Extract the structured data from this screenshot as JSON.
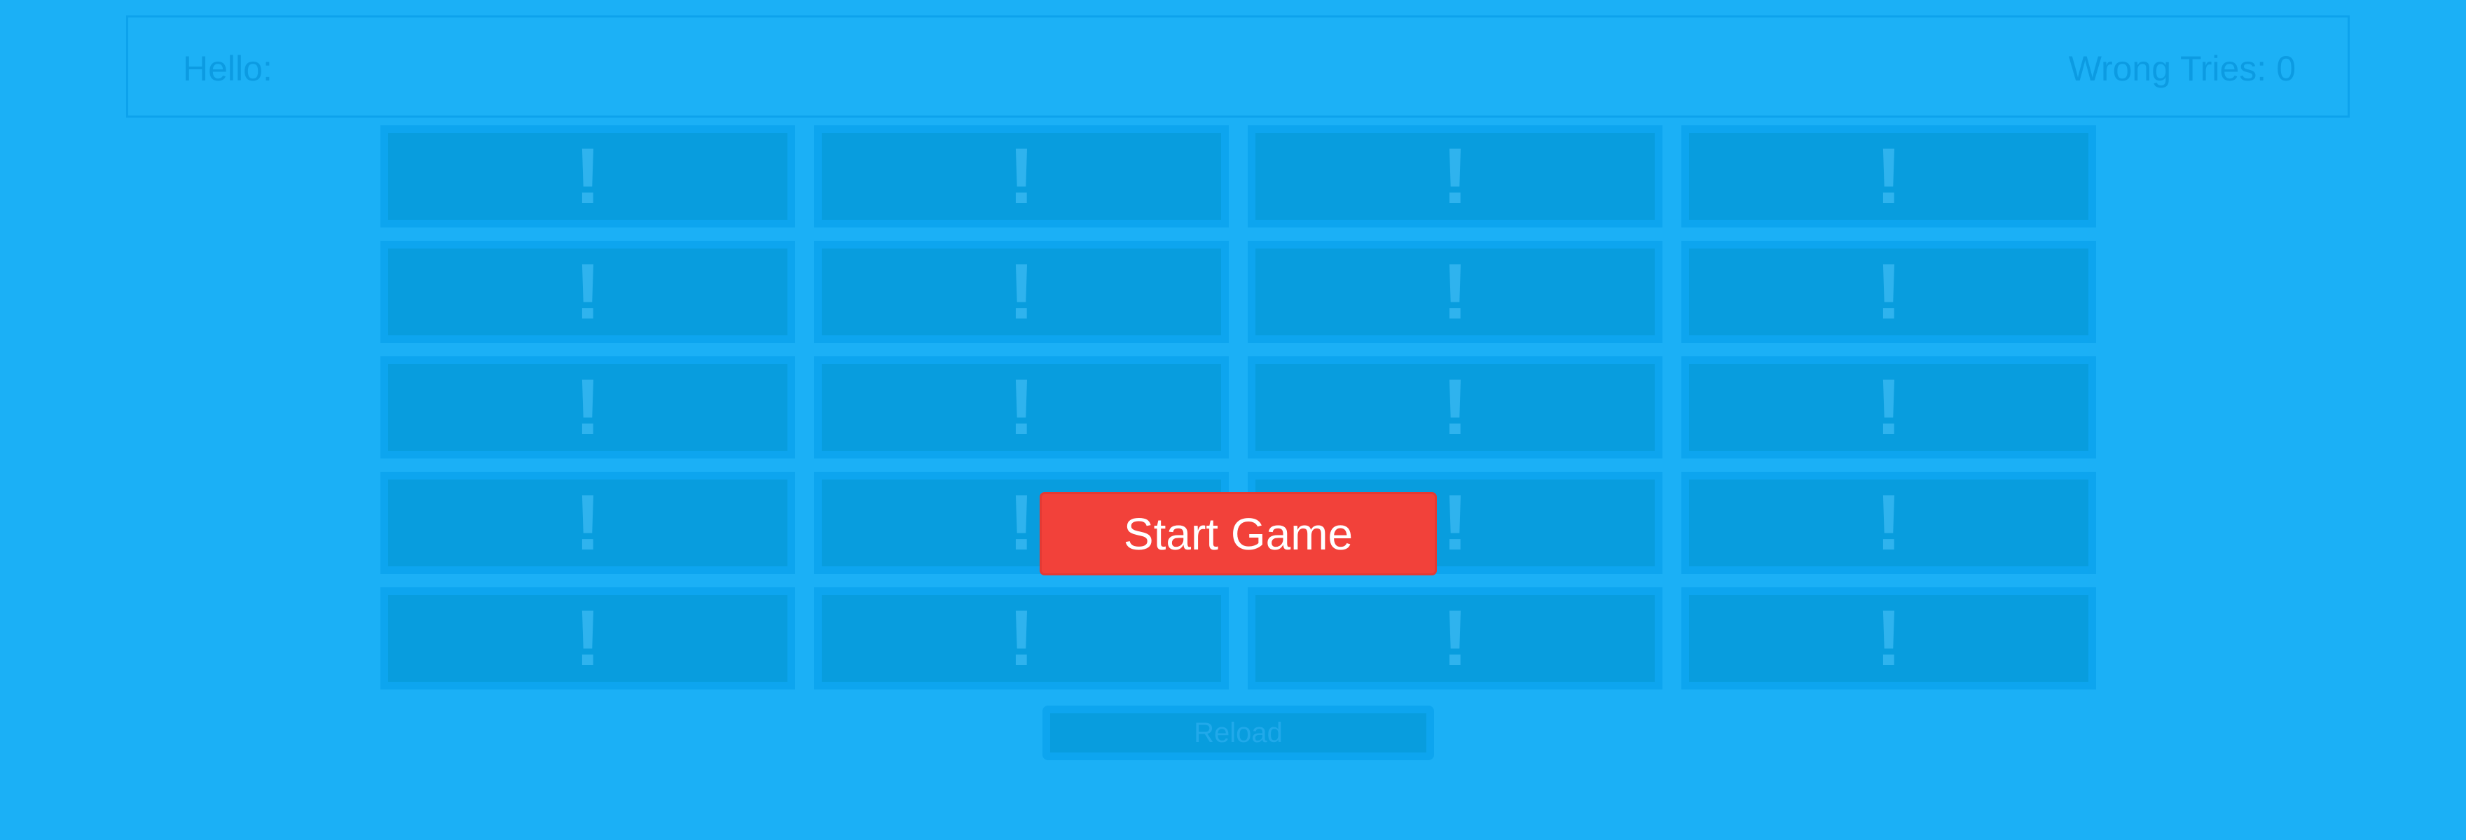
{
  "header": {
    "greeting": "Hello:",
    "wrong_tries_label": "Wrong Tries:",
    "wrong_tries_count": "0"
  },
  "board": {
    "cards": [
      {
        "symbol": "!"
      },
      {
        "symbol": "!"
      },
      {
        "symbol": "!"
      },
      {
        "symbol": "!"
      },
      {
        "symbol": "!"
      },
      {
        "symbol": "!"
      },
      {
        "symbol": "!"
      },
      {
        "symbol": "!"
      },
      {
        "symbol": "!"
      },
      {
        "symbol": "!"
      },
      {
        "symbol": "!"
      },
      {
        "symbol": "!"
      },
      {
        "symbol": "!"
      },
      {
        "symbol": "!"
      },
      {
        "symbol": "!"
      },
      {
        "symbol": "!"
      },
      {
        "symbol": "!"
      },
      {
        "symbol": "!"
      },
      {
        "symbol": "!"
      },
      {
        "symbol": "!"
      }
    ]
  },
  "start_button_label": "Start Game",
  "reload_button_label": "Reload",
  "colors": {
    "background": "#1bb0f6",
    "card_face": "#089dde",
    "card_border": "#0da5ef",
    "start_button": "#f2413a",
    "header_text": "#0c9be2"
  }
}
